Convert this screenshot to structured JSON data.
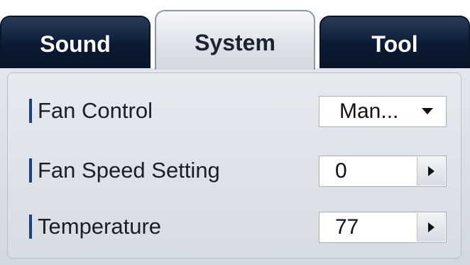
{
  "tabs": [
    {
      "label": "Sound",
      "active": false
    },
    {
      "label": "System",
      "active": true
    },
    {
      "label": "Tool",
      "active": false
    }
  ],
  "settings": {
    "fan_control": {
      "label": "Fan Control",
      "value": "Man...",
      "icon": "chevron-down-icon"
    },
    "fan_speed": {
      "label": "Fan Speed Setting",
      "value": "0",
      "icon": "arrow-right-icon"
    },
    "temperature": {
      "label": "Temperature",
      "value": "77",
      "icon": "arrow-right-icon"
    }
  },
  "colors": {
    "tab_inactive": "#0b1a33",
    "accent_bar": "#1d3f8a",
    "panel_bg": "#dfe4ea"
  }
}
